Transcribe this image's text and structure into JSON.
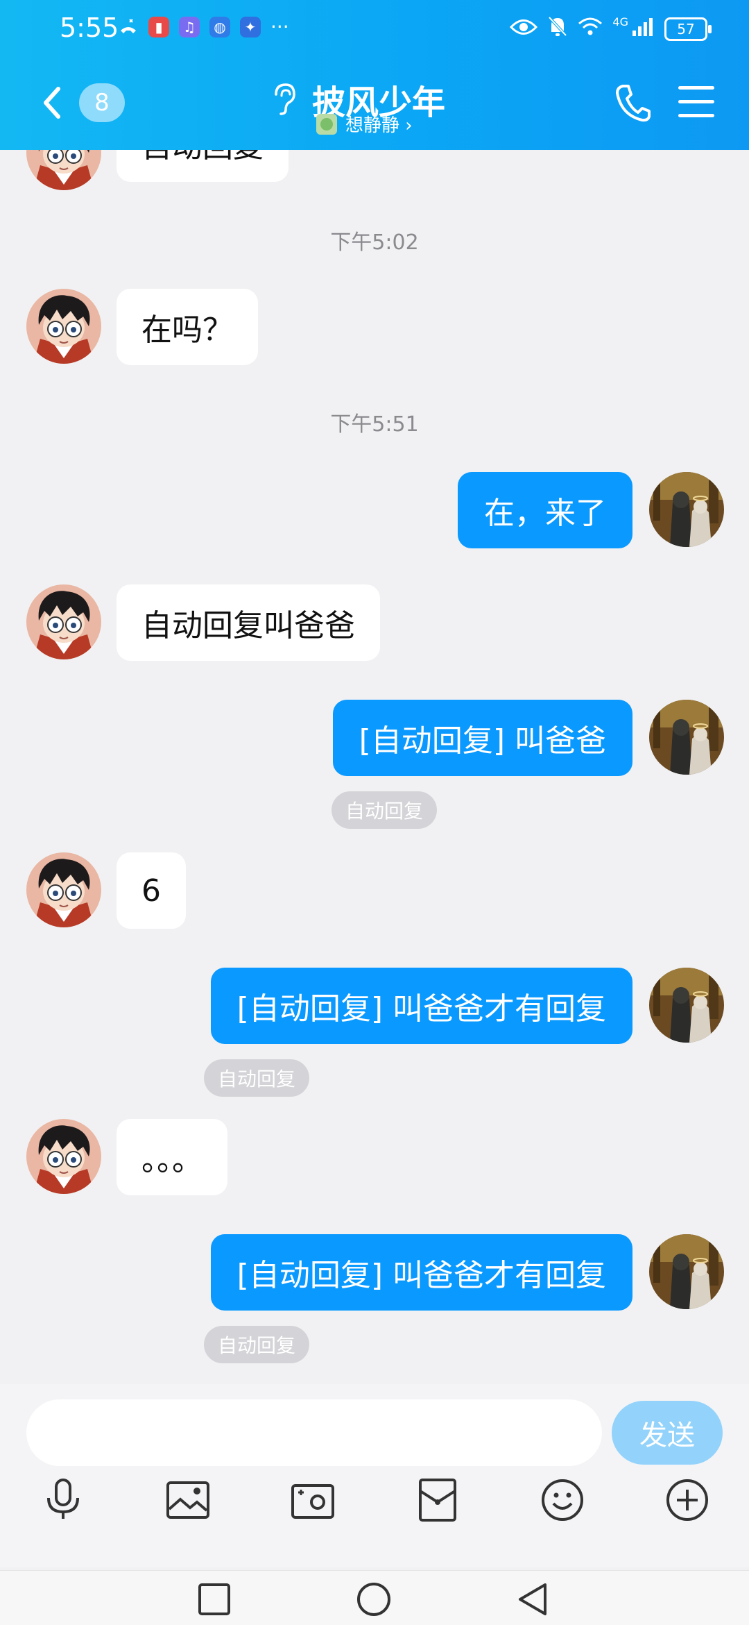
{
  "status_bar": {
    "time": "5:55",
    "more": "···",
    "network": "4G",
    "battery": "57"
  },
  "header": {
    "unread_count": "8",
    "title": "披风少年",
    "subtitle": "想静静 ›"
  },
  "messages": {
    "m0_text": "自动回复",
    "ts1": "下午5:02",
    "m1_text": "在吗？",
    "ts2": "下午5:51",
    "m2_text": "在，来了",
    "m3_text": "自动回复叫爸爸",
    "m4_text": "[自动回复] 叫爸爸",
    "m4_tag": "自动回复",
    "m5_text": "6",
    "m6_text": "[自动回复] 叫爸爸才有回复",
    "m6_tag": "自动回复",
    "m7_text": "。。。",
    "m8_text": "[自动回复] 叫爸爸才有回复",
    "m8_tag": "自动回复"
  },
  "input": {
    "value": "",
    "send_label": "发送"
  },
  "colors": {
    "header_bg": "#0ba6f5",
    "outgoing_bubble": "#0a99ff",
    "incoming_bubble": "#ffffff",
    "send_button": "#93d3fb"
  },
  "icons": {
    "toolbar": [
      "microphone-icon",
      "image-icon",
      "camera-icon",
      "red-packet-icon",
      "emoji-icon",
      "plus-icon"
    ],
    "nav": [
      "recents-icon",
      "home-icon",
      "back-nav-icon"
    ]
  }
}
